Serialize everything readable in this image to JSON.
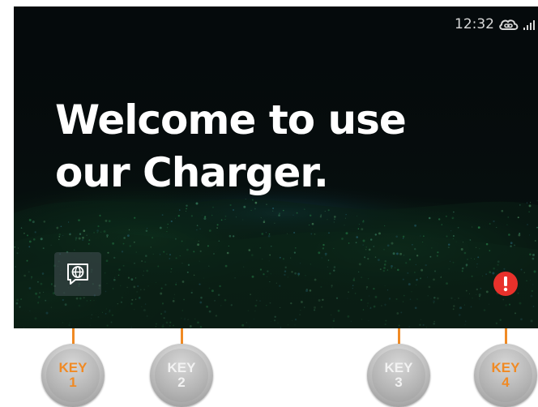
{
  "status_bar": {
    "time": "12:32"
  },
  "welcome": {
    "line1": "Welcome to use",
    "line2": "our Charger."
  },
  "keys": [
    {
      "label": "KEY",
      "number": "1",
      "color": "#f08a24"
    },
    {
      "label": "KEY",
      "number": "2",
      "color": "#f2f2f2"
    },
    {
      "label": "KEY",
      "number": "3",
      "color": "#f2f2f2"
    },
    {
      "label": "KEY",
      "number": "4",
      "color": "#f08a24"
    }
  ],
  "icons": {
    "language": "globe-chat-icon",
    "alert": "exclamation-icon",
    "cloud": "cloud-link-icon",
    "signal": "signal-bars-icon"
  },
  "colors": {
    "accent": "#f08a24",
    "alert": "#e8312b",
    "screen_bg": "#050a0c"
  }
}
